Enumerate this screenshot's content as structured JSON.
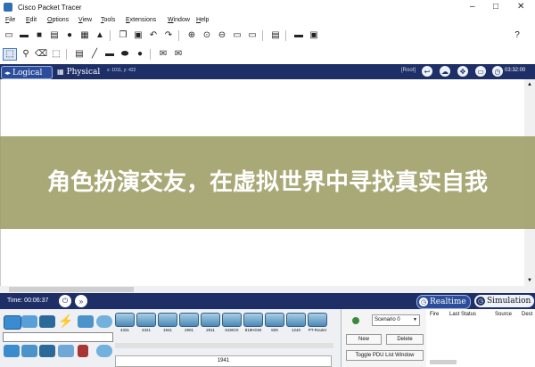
{
  "window": {
    "title": "Cisco Packet Tracer",
    "minimize": "–",
    "maximize": "□",
    "close": "✕"
  },
  "menu": [
    {
      "label": "File",
      "key": "F",
      "rest": "ile"
    },
    {
      "label": "Edit",
      "key": "E",
      "rest": "dit"
    },
    {
      "label": "Options",
      "key": "O",
      "rest": "ptions"
    },
    {
      "label": "View",
      "key": "V",
      "rest": "iew"
    },
    {
      "label": "Tools",
      "key": "T",
      "rest": "ools"
    },
    {
      "label": "Extensions",
      "key": "E",
      "rest": "xtensions"
    },
    {
      "label": "Window",
      "key": "W",
      "rest": "indow"
    },
    {
      "label": "Help",
      "key": "H",
      "rest": "elp"
    }
  ],
  "toolbar": {
    "help": "?"
  },
  "workspace": {
    "logical_label": "Logical",
    "physical_label": "Physical",
    "coords": "x: 1011, y: 422",
    "root": "[Root]",
    "time": "03:32:00"
  },
  "banner": {
    "text": "角色扮演交友，在虚拟世界中寻找真实自我"
  },
  "timebar": {
    "time": "Time: 00:06:37"
  },
  "modes": {
    "realtime": "Realtime",
    "simulation": "Simulation"
  },
  "devices": [
    "4331",
    "4321",
    "1941",
    "2901",
    "2911",
    "819IOX",
    "819HGW",
    "829",
    "1240",
    "PT-Router"
  ],
  "model_name": "1941",
  "pdu": {
    "scenario": "Scenario 0",
    "new": "New",
    "delete": "Delete",
    "toggle": "Toggle PDU List Window",
    "columns": [
      "Fire",
      "Last Status",
      "Source",
      "Dest"
    ]
  },
  "colors": {
    "accent": "#1d2f66",
    "banner": "#a0a068"
  }
}
